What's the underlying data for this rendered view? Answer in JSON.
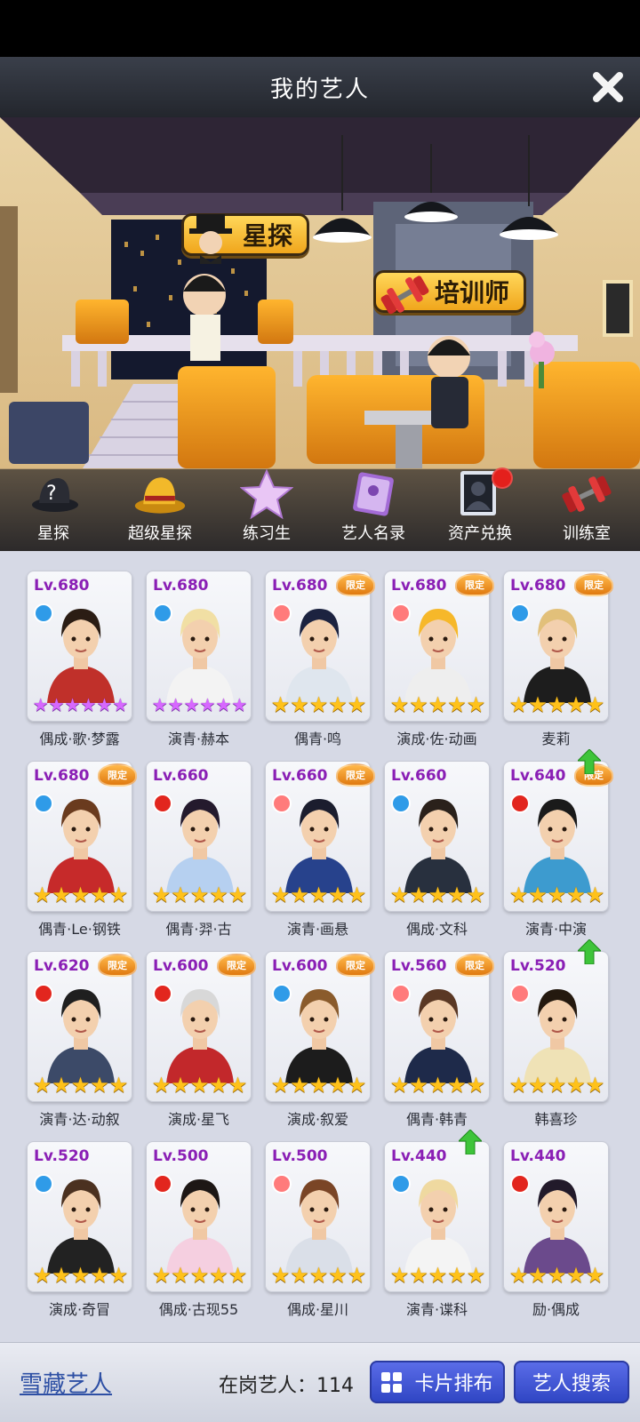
{
  "header": {
    "title": "我的艺人"
  },
  "scene": {
    "scout_sign": "星探",
    "trainer_sign": "培训师"
  },
  "menu": [
    {
      "label": "星探",
      "icon": "question-hat-icon"
    },
    {
      "label": "超级星探",
      "icon": "gold-hat-icon"
    },
    {
      "label": "练习生",
      "icon": "star-icon"
    },
    {
      "label": "艺人名录",
      "icon": "book-icon"
    },
    {
      "label": "资产兑换",
      "icon": "silhouette-icon"
    },
    {
      "label": "训练室",
      "icon": "dumbbell-icon"
    }
  ],
  "limited_label": "限定",
  "cards": [
    {
      "level": "Lv.680",
      "name": "偶成·歌·梦露",
      "badge": "blue",
      "limited": false,
      "stars": 6,
      "star_color": "purple",
      "up": false,
      "hair": "#2b1d14",
      "shirt": "#c0302a"
    },
    {
      "level": "Lv.680",
      "name": "演青·赫本",
      "badge": "blue",
      "limited": false,
      "stars": 6,
      "star_color": "purple",
      "up": false,
      "hair": "#f1dfa4",
      "shirt": "#f3f3f3"
    },
    {
      "level": "Lv.680",
      "name": "偶青·鸣",
      "badge": "pink",
      "limited": true,
      "stars": 5,
      "star_color": "gold",
      "up": false,
      "hair": "#1c2340",
      "shirt": "#dfe6ee"
    },
    {
      "level": "Lv.680",
      "name": "演成·佐·动画",
      "badge": "pink",
      "limited": true,
      "stars": 5,
      "star_color": "gold",
      "up": false,
      "hair": "#f6b82a",
      "shirt": "#eeeeee"
    },
    {
      "level": "Lv.680",
      "name": "麦莉",
      "badge": "blue",
      "limited": true,
      "stars": 5,
      "star_color": "gold",
      "up": false,
      "hair": "#e2c07a",
      "shirt": "#1d1d1d"
    },
    {
      "level": "Lv.680",
      "name": "偶青·Le·钢铁",
      "badge": "blue",
      "limited": true,
      "stars": 5,
      "star_color": "gold",
      "up": false,
      "hair": "#6a3b1e",
      "shirt": "#c62a2a"
    },
    {
      "level": "Lv.660",
      "name": "偶青·羿·古",
      "badge": "red",
      "limited": false,
      "stars": 5,
      "star_color": "gold",
      "up": false,
      "hair": "#241a2d",
      "shirt": "#b6d0f0"
    },
    {
      "level": "Lv.660",
      "name": "演青·画悬",
      "badge": "pink",
      "limited": true,
      "stars": 5,
      "star_color": "gold",
      "up": false,
      "hair": "#1b1d2e",
      "shirt": "#27428c"
    },
    {
      "level": "Lv.660",
      "name": "偶成·文科",
      "badge": "blue",
      "limited": false,
      "stars": 5,
      "star_color": "gold",
      "up": false,
      "hair": "#2a211b",
      "shirt": "#28303e"
    },
    {
      "level": "Lv.640",
      "name": "演青·中演",
      "badge": "red",
      "limited": true,
      "stars": 5,
      "star_color": "gold",
      "up": true,
      "hair": "#1a1a1a",
      "shirt": "#3d9bcf"
    },
    {
      "level": "Lv.620",
      "name": "演青·达·动叙",
      "badge": "red",
      "limited": true,
      "stars": 5,
      "star_color": "gold",
      "up": false,
      "hair": "#1f1f1f",
      "shirt": "#3c4a68"
    },
    {
      "level": "Lv.600",
      "name": "演成·星飞",
      "badge": "red",
      "limited": true,
      "stars": 5,
      "star_color": "gold",
      "up": false,
      "hair": "#d8d8d8",
      "shirt": "#c2282b"
    },
    {
      "level": "Lv.600",
      "name": "演成·叙爱",
      "badge": "blue",
      "limited": true,
      "stars": 5,
      "star_color": "gold",
      "up": false,
      "hair": "#8a5b2c",
      "shirt": "#1c1c1c"
    },
    {
      "level": "Lv.560",
      "name": "偶青·韩青",
      "badge": "pink",
      "limited": true,
      "stars": 5,
      "star_color": "gold",
      "up": false,
      "hair": "#5a3824",
      "shirt": "#1e2a4a"
    },
    {
      "level": "Lv.520",
      "name": "韩喜珍",
      "badge": "pink",
      "limited": false,
      "stars": 5,
      "star_color": "gold",
      "up": true,
      "hair": "#24190f",
      "shirt": "#efe2b6"
    },
    {
      "level": "Lv.520",
      "name": "演成·奇冒",
      "badge": "blue",
      "limited": false,
      "stars": 5,
      "star_color": "gold",
      "up": false,
      "hair": "#4b3120",
      "shirt": "#222222"
    },
    {
      "level": "Lv.500",
      "name": "偶成·古现55",
      "badge": "red",
      "limited": false,
      "stars": 5,
      "star_color": "gold",
      "up": false,
      "hair": "#1d1715",
      "shirt": "#f5cfe0"
    },
    {
      "level": "Lv.500",
      "name": "偶成·星川",
      "badge": "pink",
      "limited": false,
      "stars": 5,
      "star_color": "gold",
      "up": false,
      "hair": "#7a4526",
      "shirt": "#dadfe8"
    },
    {
      "level": "Lv.440",
      "name": "演青·谍科",
      "badge": "blue",
      "limited": false,
      "stars": 5,
      "star_color": "gold",
      "up": true,
      "hair": "#efd9a0",
      "shirt": "#f4f4f4"
    },
    {
      "level": "Lv.440",
      "name": "励·偶成",
      "badge": "red",
      "limited": false,
      "stars": 5,
      "star_color": "gold",
      "up": false,
      "hair": "#221a2a",
      "shirt": "#6b4a8c"
    }
  ],
  "footer": {
    "hidden_artists": "雪藏艺人",
    "active_count_label": "在岗艺人：114",
    "layout_button": "卡片排布",
    "search_button": "艺人搜索"
  }
}
